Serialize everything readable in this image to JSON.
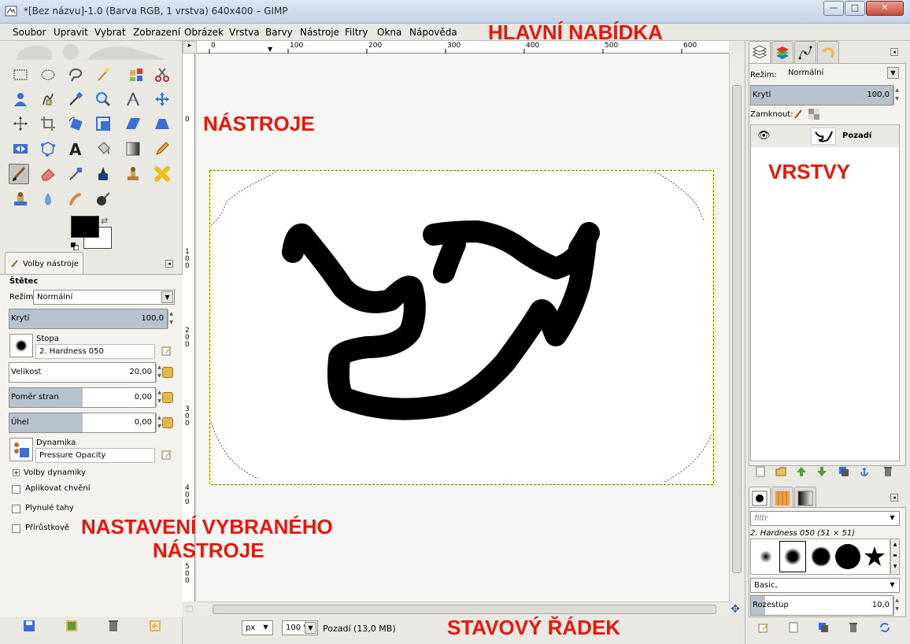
{
  "window": {
    "title": "*[Bez názvu]-1.0 (Barva RGB, 1 vrstva) 640x400 – GIMP",
    "min_label": "—",
    "max_label": "□",
    "close_label": "✕"
  },
  "menu": [
    "Soubor",
    "Upravit",
    "Vybrat",
    "Zobrazení",
    "Obrázek",
    "Vrstva",
    "Barvy",
    "Nástroje",
    "Filtry",
    "Okna",
    "Nápověda"
  ],
  "toolbox": {
    "tool_options_tab": "Volby nástroje",
    "tool_name": "Štětec",
    "mode_label": "Režim:",
    "mode_value": "Normální",
    "opacity": {
      "label": "Krytí",
      "value": "100,0",
      "fraction": 1.0
    },
    "brush_label": "Stopa",
    "brush_value": "2. Hardness 050",
    "size": {
      "label": "Velikost",
      "value": "20,00",
      "fraction": 0.0
    },
    "aspect": {
      "label": "Poměr stran",
      "value": "0,00",
      "fraction": 0.5
    },
    "angle": {
      "label": "Úhel",
      "value": "0,00",
      "fraction": 0.5
    },
    "dynamics_label": "Dynamika",
    "dynamics_value": "Pressure Opacity",
    "dynamics_options": "Volby dynamiky",
    "check_jitter": "Aplikovat chvění",
    "check_smooth": "Plynulé tahy",
    "check_incremental": "Přírůstkově"
  },
  "rulers": {
    "h_ticks": [
      "0",
      "100",
      "200",
      "300",
      "400",
      "500",
      "600"
    ],
    "v_ticks": [
      "0",
      "1\n0\n0",
      "2\n0\n0",
      "3\n0\n0",
      "4\n0\n0",
      "5\n0\n0"
    ]
  },
  "statusbar": {
    "unit": "px",
    "zoom": "100 %",
    "info": "Pozadí (13,0 MB)"
  },
  "layers": {
    "mode_label": "Režim:",
    "mode_value": "Normální",
    "opacity": {
      "label": "Krytí",
      "value": "100,0",
      "fraction": 1.0
    },
    "lock_label": "Zamknout:",
    "layer_name": "Pozadí"
  },
  "brushes": {
    "filter_placeholder": "filtr",
    "current": "2. Hardness 050 (51 × 51)",
    "tag": "Basic,",
    "spacing": {
      "label": "Rozestup",
      "value": "10,0",
      "fraction": 0.1
    }
  },
  "annotations": {
    "menu": "HLAVNÍ NABÍDKA",
    "tools": "NÁSTROJE",
    "layers": "VRSTVY",
    "options_line1": "NASTAVENÍ VYBRANÉHO",
    "options_line2": "NÁSTROJE",
    "status": "STAVOVÝ ŘÁDEK"
  },
  "colors": {
    "annotation": "#e8170a",
    "foreground": "#000000",
    "background": "#ffffff",
    "selection_dash": "#ffff00"
  }
}
